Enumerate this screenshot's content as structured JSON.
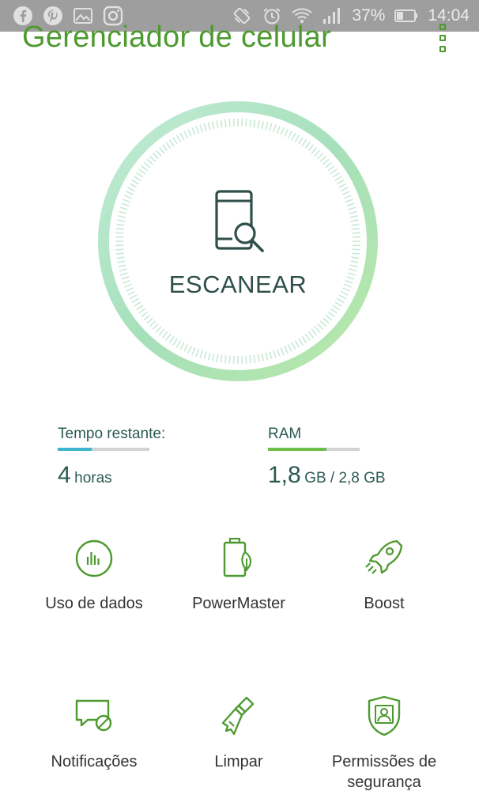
{
  "status_bar": {
    "left_icons": [
      "facebook-icon",
      "pinterest-icon",
      "gallery-icon",
      "instagram-icon"
    ],
    "right_icons": [
      "vibrate-icon",
      "alarm-icon",
      "wifi-icon",
      "signal-icon"
    ],
    "battery": "37%",
    "time": "14:04"
  },
  "header": {
    "title": "Gerenciador de celular"
  },
  "scan": {
    "label": "ESCANEAR"
  },
  "stats": {
    "time_left": {
      "label": "Tempo restante:",
      "value": "4",
      "unit": "horas",
      "fill": 0.37,
      "color": "#3fb4cf"
    },
    "ram": {
      "label": "RAM",
      "value": "1,8",
      "unit": "GB / 2,8 GB",
      "fill": 0.64,
      "color": "#6cc04a"
    }
  },
  "tools": [
    {
      "label": "Uso de dados",
      "icon": "data-usage-icon"
    },
    {
      "label": "PowerMaster",
      "icon": "battery-leaf-icon"
    },
    {
      "label": "Boost",
      "icon": "rocket-icon"
    },
    {
      "label": "Notificações",
      "icon": "notification-block-icon"
    },
    {
      "label": "Limpar",
      "icon": "broom-icon"
    },
    {
      "label": "Permissões de segurança",
      "icon": "shield-user-icon"
    }
  ],
  "colors": {
    "accent": "#4d9a2f",
    "ring": "#b8e6c4",
    "text": "#2a5a52"
  }
}
